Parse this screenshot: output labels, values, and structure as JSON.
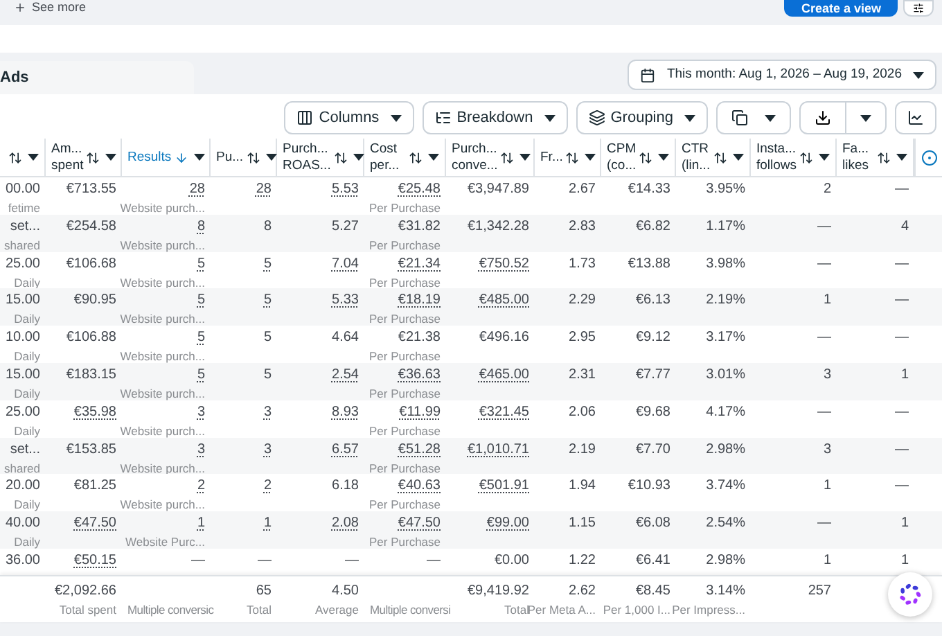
{
  "top": {
    "see_more": "See more",
    "create_view": "Create a view"
  },
  "tab": "Ads",
  "date_range": "This month: Aug 1, 2026 – Aug 19, 2026",
  "toolbar": [
    {
      "kind": "menu",
      "label": "Columns"
    },
    {
      "kind": "menu",
      "label": "Breakdown"
    },
    {
      "kind": "menu",
      "label": "Grouping"
    },
    {
      "kind": "icon-menu"
    },
    {
      "kind": "split"
    },
    {
      "kind": "icon"
    }
  ],
  "columns": [
    {
      "kind": "data",
      "sorted": false
    },
    {
      "kind": "data",
      "lines": [
        "Am...",
        "spent"
      ],
      "sorted": false
    },
    {
      "kind": "data",
      "lines": [
        "Results"
      ],
      "sorted": true
    },
    {
      "kind": "data",
      "lines": [
        "Pu..."
      ],
      "sorted": false
    },
    {
      "kind": "data",
      "lines": [
        "Purch...",
        "ROAS..."
      ],
      "sorted": false
    },
    {
      "kind": "data",
      "lines": [
        "Cost",
        "per..."
      ],
      "sorted": false
    },
    {
      "kind": "data",
      "lines": [
        "Purch...",
        "conve..."
      ],
      "sorted": false
    },
    {
      "kind": "data",
      "lines": [
        "Fr..."
      ],
      "sorted": false
    },
    {
      "kind": "data",
      "lines": [
        "CPM",
        "(co..."
      ],
      "sorted": false
    },
    {
      "kind": "data",
      "lines": [
        "CTR",
        "(lin..."
      ],
      "sorted": false
    },
    {
      "kind": "data",
      "lines": [
        "Insta...",
        "follows"
      ],
      "sorted": false
    },
    {
      "kind": "data",
      "lines": [
        "Fa...",
        "likes"
      ],
      "sorted": false
    },
    {
      "kind": "edge"
    }
  ],
  "rows": [
    {
      "cells": [
        {
          "value": "00.00",
          "note": "fetime",
          "linked": false
        },
        {
          "value": "€713.55",
          "linked": false
        },
        {
          "value": "28",
          "note": "Website purch...",
          "linked": true
        },
        {
          "value": "28",
          "linked": true
        },
        {
          "value": "5.53",
          "linked": true
        },
        {
          "value": "€25.48",
          "note": "Per Purchase",
          "linked": true
        },
        {
          "value": "€3,947.89",
          "linked": false
        },
        {
          "value": "2.67",
          "linked": false
        },
        {
          "value": "€14.33",
          "linked": false
        },
        {
          "value": "3.95%",
          "linked": false
        },
        {
          "value": "2",
          "linked": false
        },
        {
          "value": "—",
          "linked": false
        }
      ]
    },
    {
      "cells": [
        {
          "value": "set...",
          "note": "shared",
          "linked": false
        },
        {
          "value": "€254.58",
          "linked": false
        },
        {
          "value": "8",
          "note": "Website purch...",
          "linked": true
        },
        {
          "value": "8",
          "linked": false
        },
        {
          "value": "5.27",
          "linked": false
        },
        {
          "value": "€31.82",
          "note": "Per Purchase",
          "linked": false
        },
        {
          "value": "€1,342.28",
          "linked": false
        },
        {
          "value": "2.83",
          "linked": false
        },
        {
          "value": "€6.82",
          "linked": false
        },
        {
          "value": "1.17%",
          "linked": false
        },
        {
          "value": "—",
          "linked": false
        },
        {
          "value": "4",
          "linked": false
        }
      ]
    },
    {
      "cells": [
        {
          "value": "25.00",
          "note": "Daily",
          "linked": false
        },
        {
          "value": "€106.68",
          "linked": false
        },
        {
          "value": "5",
          "note": "Website purch...",
          "linked": true
        },
        {
          "value": "5",
          "linked": true
        },
        {
          "value": "7.04",
          "linked": true
        },
        {
          "value": "€21.34",
          "note": "Per Purchase",
          "linked": true
        },
        {
          "value": "€750.52",
          "linked": true
        },
        {
          "value": "1.73",
          "linked": false
        },
        {
          "value": "€13.88",
          "linked": false
        },
        {
          "value": "3.98%",
          "linked": false
        },
        {
          "value": "—",
          "linked": false
        },
        {
          "value": "—",
          "linked": false
        }
      ]
    },
    {
      "cells": [
        {
          "value": "15.00",
          "note": "Daily",
          "linked": false
        },
        {
          "value": "€90.95",
          "linked": false
        },
        {
          "value": "5",
          "note": "Website purch...",
          "linked": true
        },
        {
          "value": "5",
          "linked": true
        },
        {
          "value": "5.33",
          "linked": true
        },
        {
          "value": "€18.19",
          "note": "Per Purchase",
          "linked": true
        },
        {
          "value": "€485.00",
          "linked": true
        },
        {
          "value": "2.29",
          "linked": false
        },
        {
          "value": "€6.13",
          "linked": false
        },
        {
          "value": "2.19%",
          "linked": false
        },
        {
          "value": "1",
          "linked": false
        },
        {
          "value": "—",
          "linked": false
        }
      ]
    },
    {
      "cells": [
        {
          "value": "10.00",
          "note": "Daily",
          "linked": false
        },
        {
          "value": "€106.88",
          "linked": false
        },
        {
          "value": "5",
          "note": "Website purch...",
          "linked": true
        },
        {
          "value": "5",
          "linked": false
        },
        {
          "value": "4.64",
          "linked": false
        },
        {
          "value": "€21.38",
          "note": "Per Purchase",
          "linked": false
        },
        {
          "value": "€496.16",
          "linked": false
        },
        {
          "value": "2.95",
          "linked": false
        },
        {
          "value": "€9.12",
          "linked": false
        },
        {
          "value": "3.17%",
          "linked": false
        },
        {
          "value": "—",
          "linked": false
        },
        {
          "value": "—",
          "linked": false
        }
      ]
    },
    {
      "cells": [
        {
          "value": "15.00",
          "note": "Daily",
          "linked": false
        },
        {
          "value": "€183.15",
          "linked": false
        },
        {
          "value": "5",
          "note": "Website purch...",
          "linked": true
        },
        {
          "value": "5",
          "linked": false
        },
        {
          "value": "2.54",
          "linked": true
        },
        {
          "value": "€36.63",
          "note": "Per Purchase",
          "linked": true
        },
        {
          "value": "€465.00",
          "linked": true
        },
        {
          "value": "2.31",
          "linked": false
        },
        {
          "value": "€7.77",
          "linked": false
        },
        {
          "value": "3.01%",
          "linked": false
        },
        {
          "value": "3",
          "linked": false
        },
        {
          "value": "1",
          "linked": false
        }
      ]
    },
    {
      "cells": [
        {
          "value": "25.00",
          "note": "Daily",
          "linked": false
        },
        {
          "value": "€35.98",
          "linked": true
        },
        {
          "value": "3",
          "note": "Website purch...",
          "linked": true
        },
        {
          "value": "3",
          "linked": true
        },
        {
          "value": "8.93",
          "linked": true
        },
        {
          "value": "€11.99",
          "note": "Per Purchase",
          "linked": true
        },
        {
          "value": "€321.45",
          "linked": true
        },
        {
          "value": "2.06",
          "linked": false
        },
        {
          "value": "€9.68",
          "linked": false
        },
        {
          "value": "4.17%",
          "linked": false
        },
        {
          "value": "—",
          "linked": false
        },
        {
          "value": "—",
          "linked": false
        }
      ]
    },
    {
      "cells": [
        {
          "value": "set...",
          "note": "shared",
          "linked": false
        },
        {
          "value": "€153.85",
          "linked": false
        },
        {
          "value": "3",
          "note": "Website purch...",
          "linked": true
        },
        {
          "value": "3",
          "linked": true
        },
        {
          "value": "6.57",
          "linked": true
        },
        {
          "value": "€51.28",
          "note": "Per Purchase",
          "linked": true
        },
        {
          "value": "€1,010.71",
          "linked": true
        },
        {
          "value": "2.19",
          "linked": false
        },
        {
          "value": "€7.70",
          "linked": false
        },
        {
          "value": "2.98%",
          "linked": false
        },
        {
          "value": "3",
          "linked": false
        },
        {
          "value": "—",
          "linked": false
        }
      ]
    },
    {
      "cells": [
        {
          "value": "20.00",
          "note": "Daily",
          "linked": false
        },
        {
          "value": "€81.25",
          "linked": false
        },
        {
          "value": "2",
          "note": "Website purch...",
          "linked": true
        },
        {
          "value": "2",
          "linked": true
        },
        {
          "value": "6.18",
          "linked": false
        },
        {
          "value": "€40.63",
          "note": "Per Purchase",
          "linked": true
        },
        {
          "value": "€501.91",
          "linked": true
        },
        {
          "value": "1.94",
          "linked": false
        },
        {
          "value": "€10.93",
          "linked": false
        },
        {
          "value": "3.74%",
          "linked": false
        },
        {
          "value": "1",
          "linked": false
        },
        {
          "value": "—",
          "linked": false
        }
      ]
    },
    {
      "cells": [
        {
          "value": "40.00",
          "note": "Daily",
          "linked": false
        },
        {
          "value": "€47.50",
          "linked": true
        },
        {
          "value": "1",
          "note": "Website Purc...",
          "linked": true
        },
        {
          "value": "1",
          "linked": true
        },
        {
          "value": "2.08",
          "linked": true
        },
        {
          "value": "€47.50",
          "note": "Per Purchase",
          "linked": true
        },
        {
          "value": "€99.00",
          "linked": true
        },
        {
          "value": "1.15",
          "linked": false
        },
        {
          "value": "€6.08",
          "linked": false
        },
        {
          "value": "2.54%",
          "linked": false
        },
        {
          "value": "—",
          "linked": false
        },
        {
          "value": "1",
          "linked": false
        }
      ]
    },
    {
      "cells": [
        {
          "value": "36.00",
          "linked": false
        },
        {
          "value": "€50.15",
          "linked": true
        },
        {
          "value": "—",
          "linked": false
        },
        {
          "value": "—",
          "linked": false
        },
        {
          "value": "—",
          "linked": false
        },
        {
          "value": "—",
          "linked": false
        },
        {
          "value": "€0.00",
          "linked": false
        },
        {
          "value": "1.22",
          "linked": false
        },
        {
          "value": "€6.41",
          "linked": false
        },
        {
          "value": "2.98%",
          "linked": false
        },
        {
          "value": "1",
          "linked": false
        },
        {
          "value": "1",
          "linked": false
        }
      ]
    }
  ],
  "totals": [
    {
      "value": "€2,092.66",
      "note": "Total spent"
    },
    {
      "note": "Multiple conversic"
    },
    {
      "value": "65",
      "note": "Total"
    },
    {
      "value": "4.50",
      "note": "Average"
    },
    {
      "note": "Multiple conversi"
    },
    {
      "value": "€9,419.92",
      "note": "Total"
    },
    {
      "value": "2.62",
      "note": "Per Meta A..."
    },
    {
      "value": "€8.45",
      "note": "Per 1,000 I..."
    },
    {
      "value": "3.14%",
      "note": "Per Impress..."
    },
    {
      "value": "257"
    }
  ]
}
